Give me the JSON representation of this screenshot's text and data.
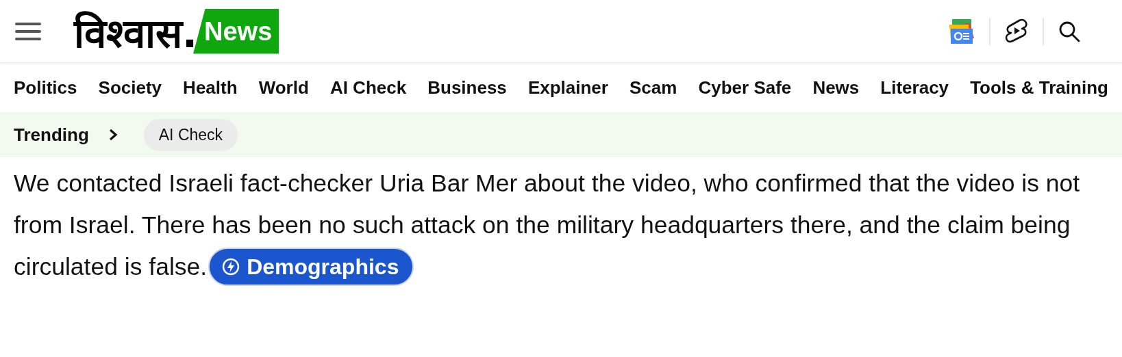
{
  "header": {
    "logo": {
      "wordmark": "विश्वास.",
      "badge": "News"
    }
  },
  "nav": {
    "items": [
      "Politics",
      "Society",
      "Health",
      "World",
      "AI Check",
      "Business",
      "Explainer",
      "Scam",
      "Cyber Safe",
      "News",
      "Literacy",
      "Tools & Training"
    ]
  },
  "trending": {
    "label": "Trending",
    "chips": [
      "AI Check"
    ]
  },
  "article": {
    "paragraph": "We contacted Israeli fact-checker Uria Bar Mer about the video, who confirmed that the video is not from Israel. There has been no such attack on the military headquarters there, and the claim being circulated is false.",
    "tag_button": "Demographics"
  }
}
